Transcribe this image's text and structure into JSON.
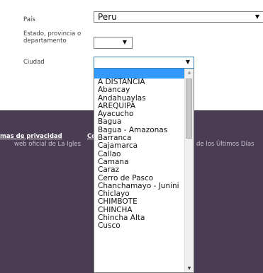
{
  "form": {
    "country_label": "País",
    "country_value": "Peru",
    "state_label_1": "Estado, provincia o",
    "state_label_2": "departamento",
    "state_value": "",
    "city_label": "Ciudad",
    "city_value": ""
  },
  "footer": {
    "privacy_link": "mas de privacidad",
    "second_link": "Co",
    "line_left": "web oficial de La Igles",
    "line_right": "de los Últimos Días"
  },
  "dropdown": {
    "options": [
      "",
      "A DISTANCIA",
      "Abancay",
      "Andahuaylas",
      "AREQUIPA",
      "Ayacucho",
      "Bagua",
      "Bagua - Amazonas",
      "Barranca",
      "Cajamarca",
      "Callao",
      "Camana",
      "Caraz",
      "Cerro de Pasco",
      "Chanchamayo - Junini",
      "Chiclayo",
      "CHIMBOTE",
      "CHINCHA",
      "Chincha Alta",
      "Cusco"
    ]
  },
  "icons": {
    "dropdown_arrow": "triangle-down-icon",
    "scroll_up": "triangle-up-icon",
    "scroll_down": "triangle-down-icon"
  },
  "colors": {
    "footer_bg": "#4a3d53",
    "highlight": "#3399ff"
  }
}
